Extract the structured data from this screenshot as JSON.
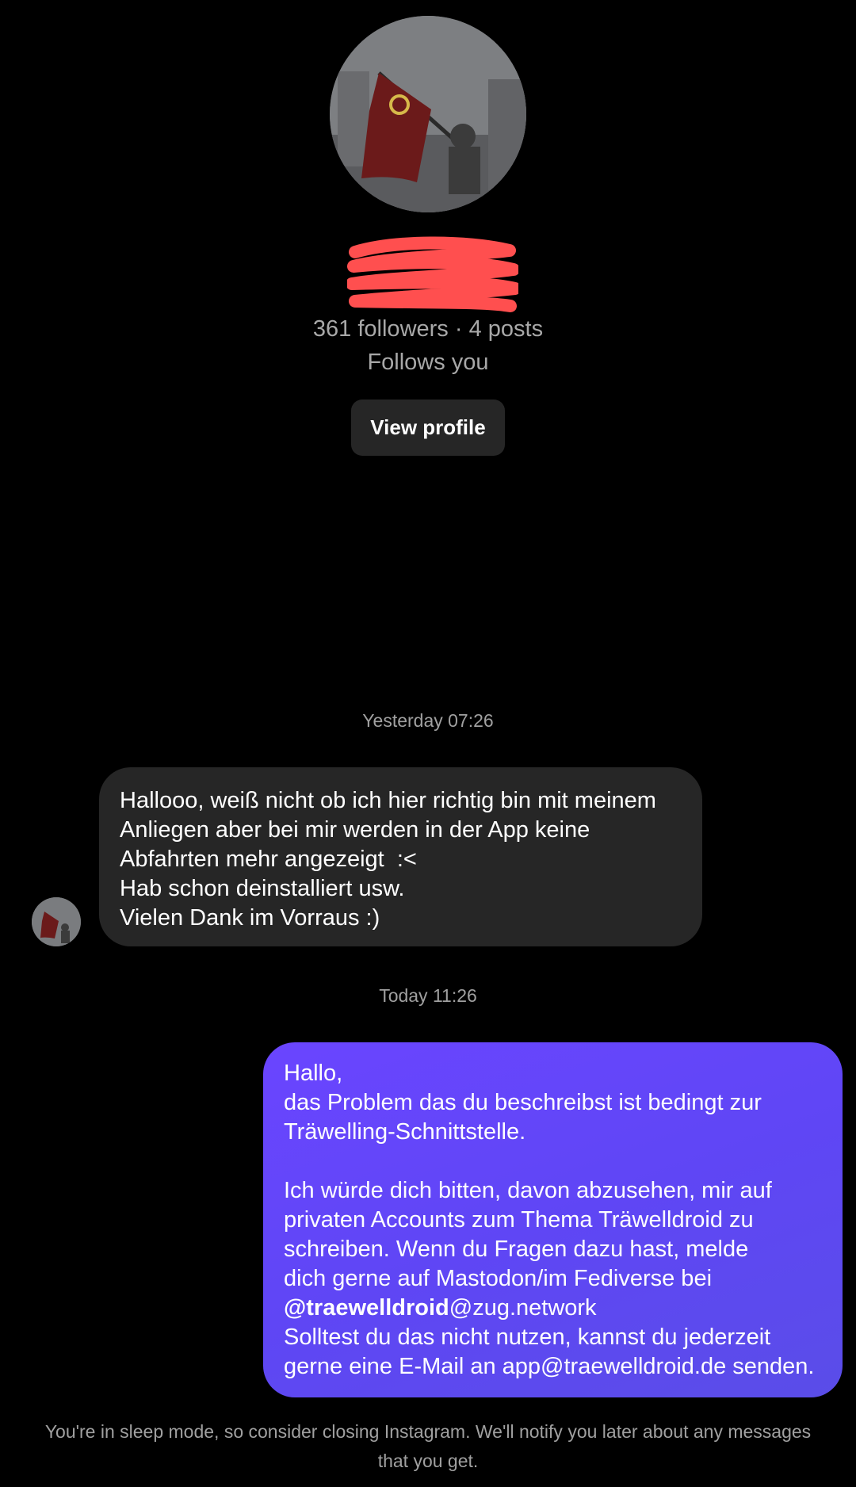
{
  "profile": {
    "avatar_icon": "profile-photo-flag",
    "stats": "361 followers · 4 posts",
    "follows_you": "Follows you",
    "view_profile_label": "View profile",
    "redaction_color": "#ff4f4f"
  },
  "thread": {
    "timestamp_1": "Yesterday 07:26",
    "incoming_message": {
      "lines": [
        "Hallooo, weiß nicht ob ich hier richtig bin mit meinem",
        "Anliegen aber bei mir werden in der App keine",
        "Abfahrten mehr angezeigt  :<",
        "Hab schon deinstalliert usw.",
        "Vielen Dank im Vorraus :)"
      ]
    },
    "timestamp_2": "Today 11:26",
    "outgoing_message": {
      "line_1": "Hallo,",
      "line_2": "das Problem das du beschreibst ist bedingt zur",
      "line_3": "Träwelling-Schnittstelle.",
      "line_4": "Ich würde dich bitten, davon abzusehen, mir auf",
      "line_5": "privaten Accounts zum Thema Träwelldroid zu",
      "line_6": "schreiben. Wenn du Fragen dazu hast, melde",
      "line_7": "dich gerne auf Mastodon/im Fediverse bei",
      "mention_handle": "@traewelldroid",
      "mention_domain": "@zug.network",
      "line_9": "Solltest du das nicht nutzen, kannst du jederzeit",
      "line_10": "gerne eine E-Mail an app@traewelldroid.de senden."
    },
    "incoming_bubble_color": "#262626",
    "outgoing_bubble_color": "#6346f8"
  },
  "footer": {
    "sleep_mode_notice": "You're in sleep mode, so consider closing Instagram. We'll notify you later about any messages that you get."
  }
}
